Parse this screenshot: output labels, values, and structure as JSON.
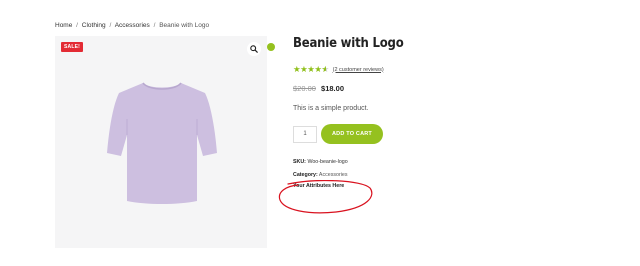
{
  "breadcrumb": {
    "home": "Home",
    "sep": "/",
    "cat1": "Clothing",
    "cat2": "Accessories",
    "current": "Beanie with Logo"
  },
  "gallery": {
    "sale_badge": "SALE!",
    "zoom_icon": "search-icon"
  },
  "product": {
    "title": "Beanie with Logo",
    "rating": 4.6,
    "reviews": "(2 customer reviews)",
    "price_old": "$20.00",
    "price_new": "$18.00",
    "description": "This is a simple product.",
    "quantity": "1",
    "add_to_cart": "ADD TO CART",
    "sku_label": "SKU:",
    "sku_value": "Woo-beanie-logo",
    "category_label": "Category:",
    "category_value": "Accessories",
    "attributes": "Your Attributes Here"
  },
  "colors": {
    "accent": "#95c11f",
    "sale": "#e32b34",
    "annotation": "#d9121f",
    "tshirt": "#cdbfe0"
  }
}
